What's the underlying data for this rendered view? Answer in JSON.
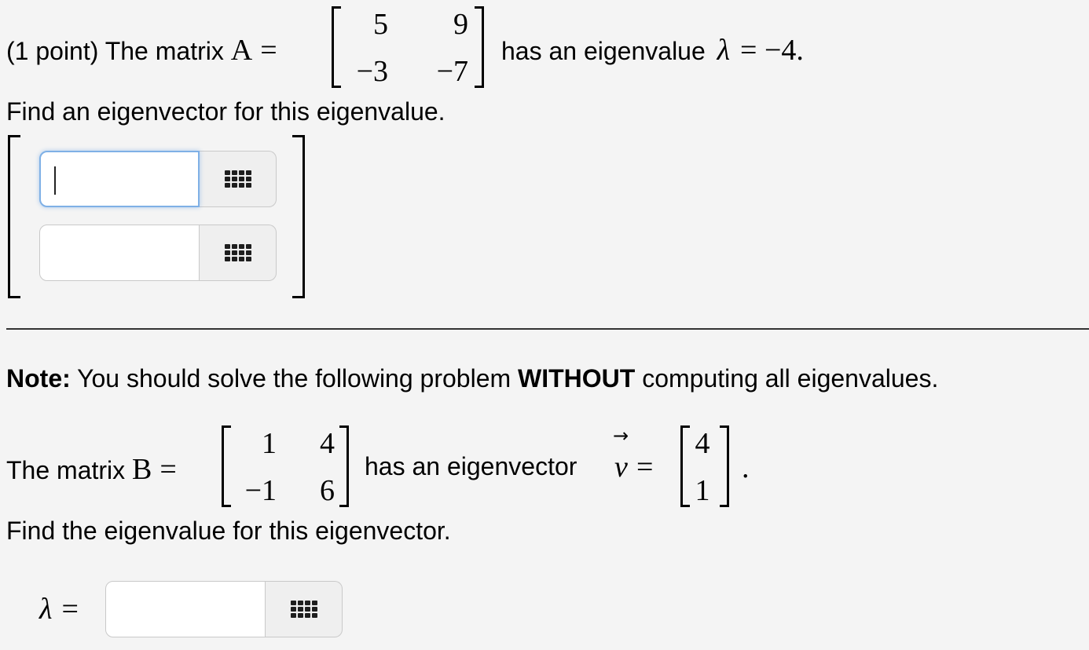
{
  "problem1": {
    "prefix": "(1 point) The matrix ",
    "matrix_name": "A",
    "equals": "=",
    "matrix": [
      [
        "5",
        "9"
      ],
      [
        "−3",
        "−7"
      ]
    ],
    "middle": "has an eigenvalue",
    "lambda_symbol": "λ",
    "lambda_value": "= −4.",
    "instruction": "Find an eigenvector for this eigenvalue.",
    "answer_fields": [
      {
        "value": "",
        "focused": true,
        "icon": "keyboard-grid-icon"
      },
      {
        "value": "",
        "focused": false,
        "icon": "keyboard-grid-icon"
      }
    ]
  },
  "problem2": {
    "note_label": "Note:",
    "note_text_1": " You should solve the following problem ",
    "note_emphasis": "WITHOUT",
    "note_text_2": " computing all eigenvalues.",
    "prefix": "The matrix ",
    "matrix_name": "B",
    "equals": "=",
    "matrix": [
      [
        "1",
        "4"
      ],
      [
        "−1",
        "6"
      ]
    ],
    "middle": "has an eigenvector",
    "vector_symbol": "v",
    "vector_arrow": "→",
    "vector_equals": "=",
    "vector": [
      "4",
      "1"
    ],
    "period": ".",
    "instruction": "Find the eigenvalue for this eigenvector.",
    "answer_label_symbol": "λ",
    "answer_label_equals": "=",
    "answer_field": {
      "value": "",
      "icon": "keyboard-grid-icon"
    }
  }
}
